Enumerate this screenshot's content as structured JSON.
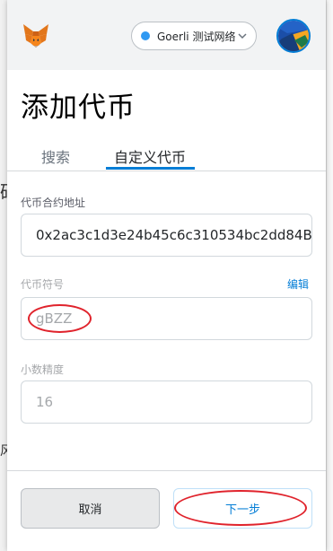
{
  "header": {
    "network": "Goerli 测试网络",
    "logo_icon": "metamask-fox-icon",
    "avatar_icon": "account-avatar-icon"
  },
  "page": {
    "title": "添加代币"
  },
  "tabs": [
    {
      "label": "搜索",
      "active": false
    },
    {
      "label": "自定义代币",
      "active": true
    }
  ],
  "form": {
    "address": {
      "label": "代币合约地址",
      "value": "0x2ac3c1d3e24b45c6c310534bc2dd84B"
    },
    "symbol": {
      "label": "代币符号",
      "value": "gBZZ",
      "edit_label": "编辑"
    },
    "decimals": {
      "label": "小数精度",
      "value": "16"
    }
  },
  "buttons": {
    "cancel": "取消",
    "next": "下一步"
  },
  "background": {
    "left_chars": [
      "硕",
      "风"
    ]
  },
  "colors": {
    "accent": "#037dd6",
    "annotation": "#e0232c"
  }
}
